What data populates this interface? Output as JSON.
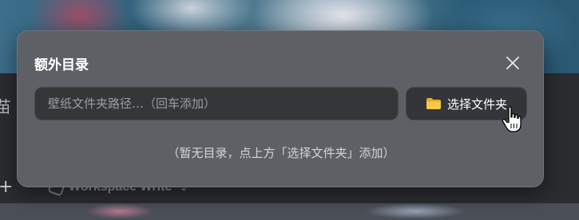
{
  "dialog": {
    "title": "额外目录",
    "path_input": {
      "value": "",
      "placeholder": "壁纸文件夹路径…（回车添加）"
    },
    "choose_folder_label": "选择文件夹",
    "empty_hint": "（暂无目录，点上方「选择文件夹」添加）"
  },
  "background": {
    "workspace_label": "Workspace Write",
    "left_glyph": "苗",
    "plus_label": "+"
  },
  "colors": {
    "dialog_bg": "#5d6165",
    "input_bg": "#343638",
    "folder_icon": "#f5c242",
    "text_primary": "#ffffff",
    "text_muted": "#d2d4d7"
  },
  "icons": {
    "close": "close-icon",
    "folder": "folder-icon",
    "cursor": "hand-pointer-cursor"
  }
}
